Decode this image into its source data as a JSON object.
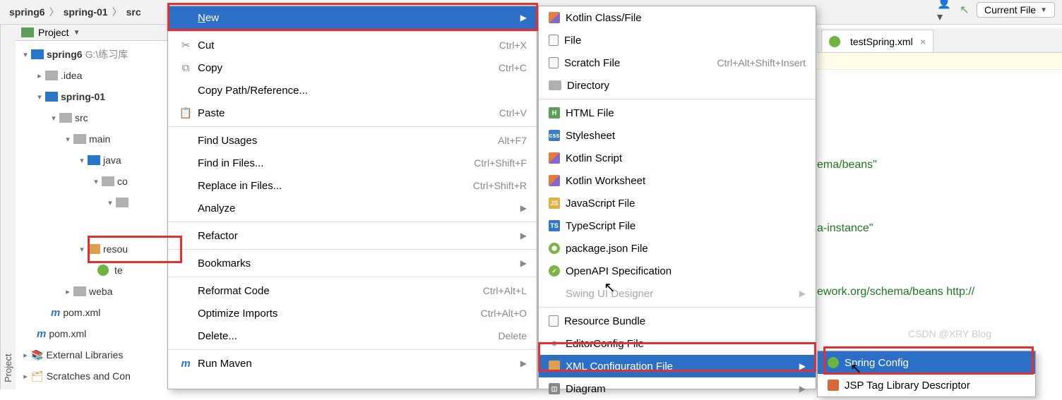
{
  "breadcrumb": {
    "p1": "spring6",
    "p2": "spring-01",
    "p3": "src"
  },
  "toolbar": {
    "currentFile": "Current File"
  },
  "sideTab": "Project",
  "panelHeader": "Project",
  "tree": {
    "root": "spring6",
    "rootPath": "G:\\练习库",
    "idea": ".idea",
    "spring01": "spring-01",
    "src": "src",
    "main": "main",
    "java": "java",
    "co": "co",
    "resou": "resou",
    "te": "te",
    "weba": "weba",
    "pom1": "pom.xml",
    "pom2": "pom.xml",
    "extLib": "External Libraries",
    "scratches": "Scratches and Con"
  },
  "menu1": {
    "new": "New",
    "cut": "Cut",
    "copy": "Copy",
    "copyPath": "Copy Path/Reference...",
    "paste": "Paste",
    "findUsages": "Find Usages",
    "findInFiles": "Find in Files...",
    "replaceInFiles": "Replace in Files...",
    "analyze": "Analyze",
    "refactor": "Refactor",
    "bookmarks": "Bookmarks",
    "reformat": "Reformat Code",
    "optimize": "Optimize Imports",
    "delete": "Delete...",
    "runMaven": "Run Maven",
    "sc": {
      "cut": "Ctrl+X",
      "copy": "Ctrl+C",
      "paste": "Ctrl+V",
      "findUsages": "Alt+F7",
      "findInFiles": "Ctrl+Shift+F",
      "replaceInFiles": "Ctrl+Shift+R",
      "reformat": "Ctrl+Alt+L",
      "optimize": "Ctrl+Alt+O",
      "delete": "Delete"
    }
  },
  "menu2": {
    "kotlin": "Kotlin Class/File",
    "file": "File",
    "scratch": "Scratch File",
    "scratchSc": "Ctrl+Alt+Shift+Insert",
    "directory": "Directory",
    "html": "HTML File",
    "stylesheet": "Stylesheet",
    "kotlinScript": "Kotlin Script",
    "kotlinWs": "Kotlin Worksheet",
    "js": "JavaScript File",
    "ts": "TypeScript File",
    "pkgJson": "package.json File",
    "openapi": "OpenAPI Specification",
    "swing": "Swing UI Designer",
    "resBundle": "Resource Bundle",
    "editorConfig": "EditorConfig File",
    "xmlConfig": "XML Configuration File",
    "diagram": "Diagram"
  },
  "menu3": {
    "spring": "Spring Config",
    "jsp": "JSP Tag Library Descriptor"
  },
  "editor": {
    "tabName": "testSpring.xml",
    "l1": "ema/beans\"",
    "l2": "a-instance\"",
    "l3": "ework.org/schema/beans http://"
  },
  "watermark": "CSDN @XRY Blog"
}
